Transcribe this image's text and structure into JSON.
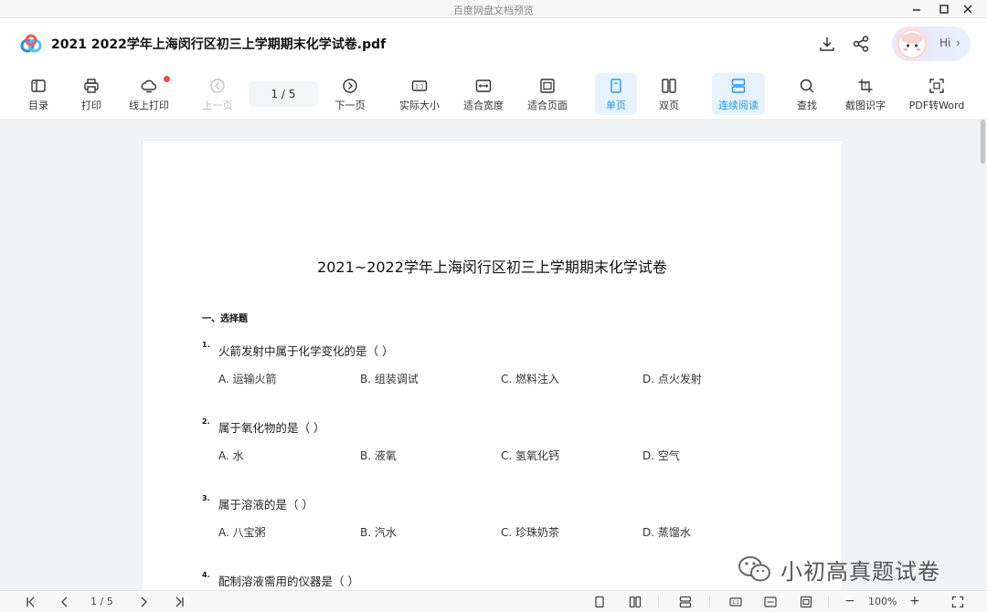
{
  "window": {
    "title": "百度网盘文档预览"
  },
  "header": {
    "filename": "2021  2022学年上海闵行区初三上学期期末化学试卷.pdf",
    "assistant_label": "Hi",
    "icons": [
      "download-icon",
      "share-icon"
    ]
  },
  "toolbar": {
    "toc": "目录",
    "print": "打印",
    "online_print": "线上打印",
    "prev_page": "上一页",
    "page_indicator": "1 / 5",
    "next_page": "下一页",
    "actual_size": "实际大小",
    "fit_width": "适合宽度",
    "fit_page": "适合页面",
    "single_page": "单页",
    "double_page": "双页",
    "continuous": "连续阅读",
    "find": "查找",
    "ocr": "截图识字",
    "pdf_to_word": "PDF转Word",
    "accent_color": "#2596e8",
    "notice_color": "#f5474f"
  },
  "document": {
    "title": "2021~2022学年上海闵行区初三上学期期末化学试卷",
    "section": "一、选择题",
    "questions": [
      {
        "num": "1.",
        "text": "火箭发射中属于化学变化的是（    ）",
        "options": [
          "A. 运输火箭",
          "B. 组装调试",
          "C. 燃料注入",
          "D. 点火发射"
        ]
      },
      {
        "num": "2.",
        "text": "属于氧化物的是（    ）",
        "options": [
          "A. 水",
          "B. 液氧",
          "C. 氢氧化钙",
          "D. 空气"
        ]
      },
      {
        "num": "3.",
        "text": "属于溶液的是（    ）",
        "options": [
          "A. 八宝粥",
          "B. 汽水",
          "C. 珍珠奶茶",
          "D. 蒸馏水"
        ]
      },
      {
        "num": "4.",
        "text": "配制溶液需用的仪器是（    ）",
        "options": []
      }
    ]
  },
  "watermark": {
    "text": "小初高真题试卷"
  },
  "statusbar": {
    "page_indicator": "1 / 5",
    "zoom": "100%",
    "zoom_out": "−",
    "zoom_in": "+"
  }
}
